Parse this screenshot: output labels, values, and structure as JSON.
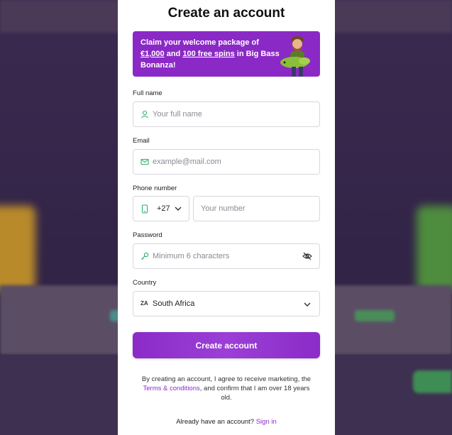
{
  "modal": {
    "title": "Create an account",
    "promo": {
      "line1": "Claim your welcome package of",
      "amount": "€1,000",
      "and": "and",
      "spins": "100 free spins",
      "suffix": "in Big Bass",
      "game": "Bonanza!"
    },
    "full_name": {
      "label": "Full name",
      "placeholder": "Your full name",
      "icon": "user-icon"
    },
    "email": {
      "label": "Email",
      "placeholder": "example@mail.com",
      "icon": "mail-icon"
    },
    "phone": {
      "label": "Phone number",
      "code": "+27",
      "placeholder": "Your number",
      "icon": "phone-icon"
    },
    "password": {
      "label": "Password",
      "placeholder": "Minimum 6 characters",
      "icon": "key-icon",
      "toggle_icon": "eye-off-icon"
    },
    "country": {
      "label": "Country",
      "flag": "ZA",
      "value": "South Africa"
    },
    "submit_label": "Create account",
    "consent": {
      "before": "By creating an account, I agree to receive marketing, the",
      "link": "Terms & conditions",
      "after": ", and confirm that I am over 18 years old."
    },
    "signin": {
      "prompt": "Already have an account?",
      "link": "Sign in"
    }
  },
  "colors": {
    "accent": "#8b2bc8",
    "icon_green": "#2fae6b",
    "field_border": "#d8d8de"
  }
}
